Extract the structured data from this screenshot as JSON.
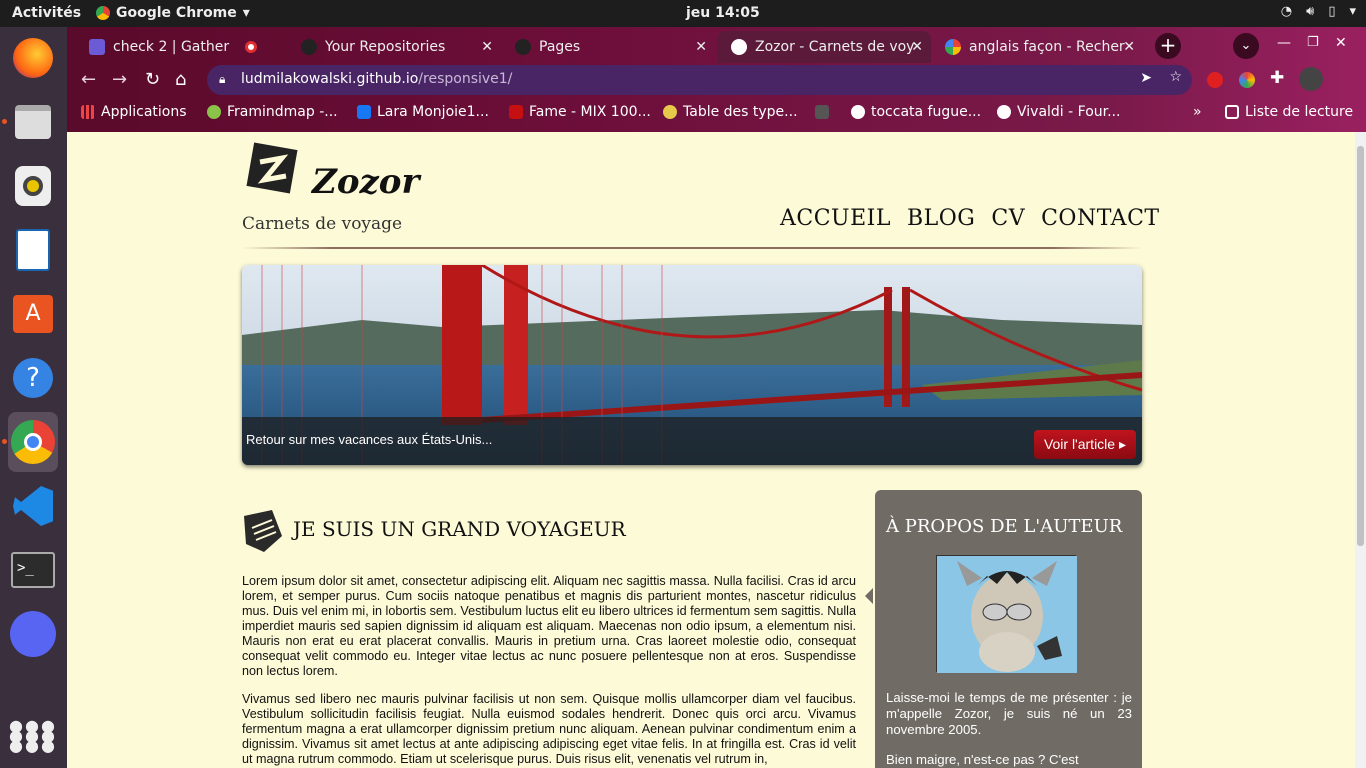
{
  "system": {
    "activities": "Activités",
    "app_name": "Google Chrome",
    "clock": "jeu 14:05"
  },
  "tabs": [
    {
      "title": "check 2 | Gather"
    },
    {
      "title": "Your Repositories"
    },
    {
      "title": "Pages"
    },
    {
      "title": "Zozor - Carnets de voy"
    },
    {
      "title": "anglais façon - Recher"
    }
  ],
  "address": {
    "host": "ludmilakowalski.github.io",
    "path": "/responsive1/"
  },
  "bookmarks": [
    "Applications",
    "Framindmap -...",
    "Lara Monjoie1...",
    "Fame - MIX 100...",
    "Table des type...",
    "toccata fugue...",
    "Vivaldi - Four...",
    "Liste de lecture"
  ],
  "site": {
    "brand": "Zozor",
    "tagline": "Carnets de voyage",
    "menu": [
      "ACCUEIL",
      "BLOG",
      "CV",
      "CONTACT"
    ],
    "banner_caption": "Retour sur mes vacances aux États-Unis...",
    "banner_button": "Voir l'article ▸",
    "article_title": "JE SUIS UN GRAND VOYAGEUR",
    "para1": "Lorem ipsum dolor sit amet, consectetur adipiscing elit. Aliquam nec sagittis massa. Nulla facilisi. Cras id arcu lorem, et semper purus. Cum sociis natoque penatibus et magnis dis parturient montes, nascetur ridiculus mus. Duis vel enim mi, in lobortis sem. Vestibulum luctus elit eu libero ultrices id fermentum sem sagittis. Nulla imperdiet mauris sed sapien dignissim id aliquam est aliquam. Maecenas non odio ipsum, a elementum nisi. Mauris non erat eu erat placerat convallis. Mauris in pretium urna. Cras laoreet molestie odio, consequat consequat velit commodo eu. Integer vitae lectus ac nunc posuere pellentesque non at eros. Suspendisse non lectus lorem.",
    "para2": "Vivamus sed libero nec mauris pulvinar facilisis ut non sem. Quisque mollis ullamcorper diam vel faucibus. Vestibulum sollicitudin facilisis feugiat. Nulla euismod sodales hendrerit. Donec quis orci arcu. Vivamus fermentum magna a erat ullamcorper dignissim pretium nunc aliquam. Aenean pulvinar condimentum enim a dignissim. Vivamus sit amet lectus at ante adipiscing adipiscing eget vitae felis. In at fringilla est. Cras id velit ut magna rutrum commodo. Etiam ut scelerisque purus. Duis risus elit, venenatis vel rutrum in,",
    "aside_title": "À PROPOS DE L'AUTEUR",
    "aside_p1": "Laisse-moi le temps de me présenter : je m'appelle Zozor, je suis né un 23 novembre 2005.",
    "aside_p2": "Bien maigre, n'est-ce pas ? C'est"
  }
}
